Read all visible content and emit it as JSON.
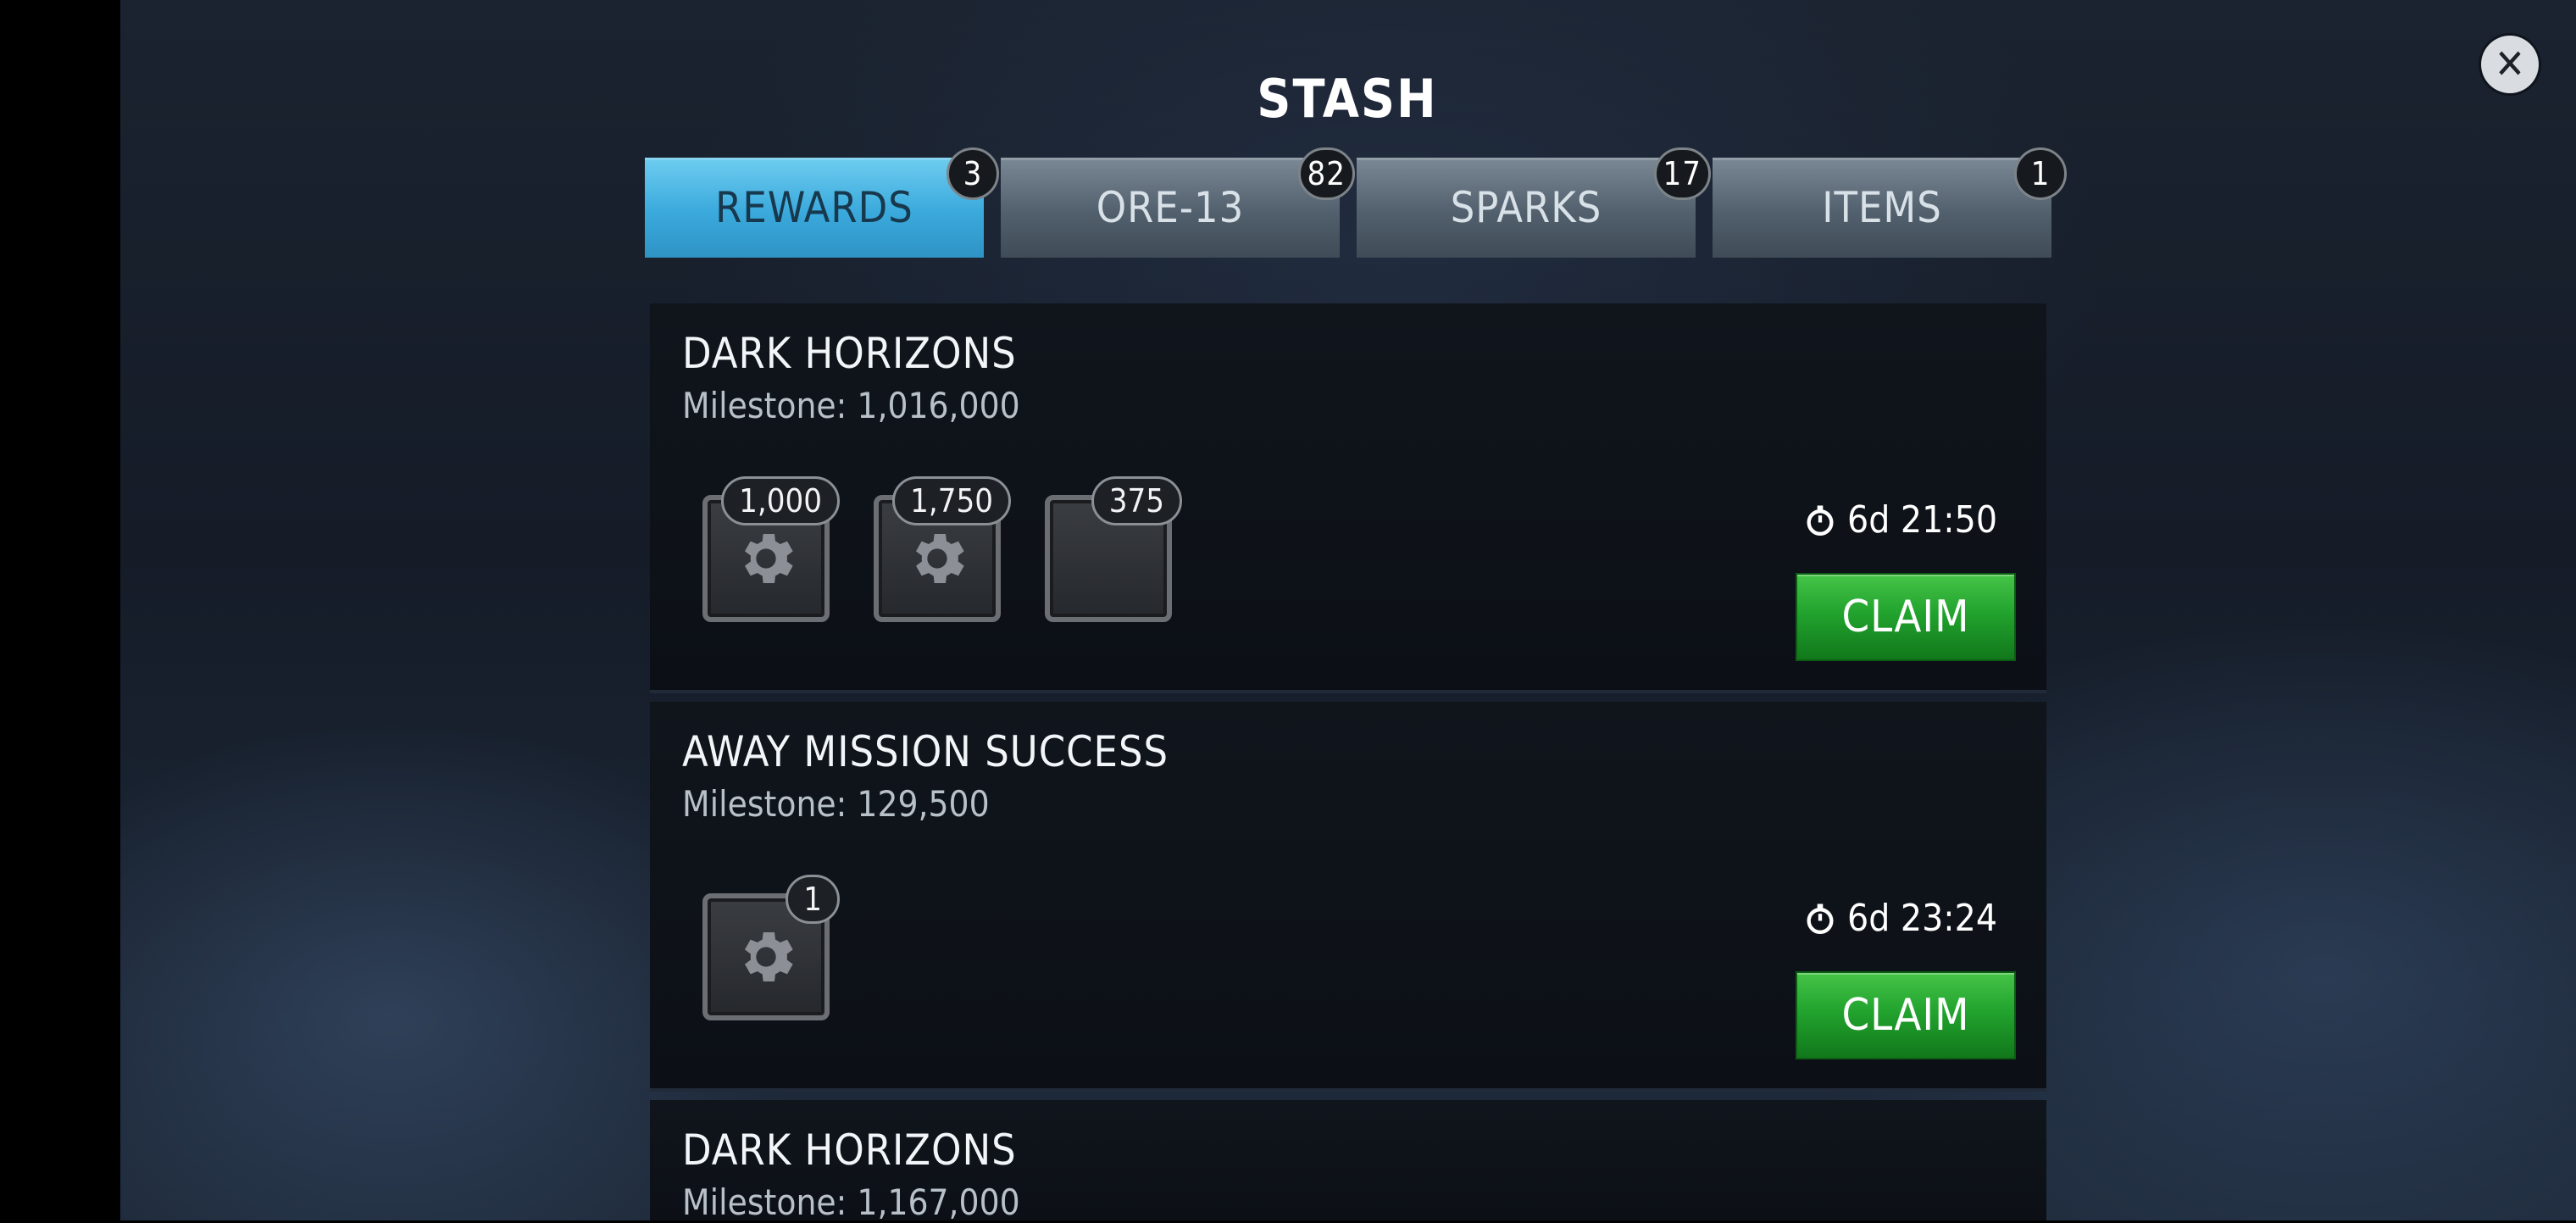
{
  "window": {
    "title": "STASH",
    "close_icon": "close-icon"
  },
  "tabs": [
    {
      "label": "REWARDS",
      "badge": "3",
      "active": true
    },
    {
      "label": "ORE-13",
      "badge": "82",
      "active": false
    },
    {
      "label": "SPARKS",
      "badge": "17",
      "active": false
    },
    {
      "label": "ITEMS",
      "badge": "1",
      "active": false
    }
  ],
  "rewards": [
    {
      "title": "DARK HORIZONS",
      "milestone": "Milestone: 1,016,000",
      "items": [
        {
          "icon": "gear-icon",
          "count": "1,000"
        },
        {
          "icon": "gear-icon",
          "count": "1,750"
        },
        {
          "icon": "",
          "count": "375"
        }
      ],
      "timer": "6d 21:50",
      "claim_label": "CLAIM"
    },
    {
      "title": "AWAY MISSION SUCCESS",
      "milestone": "Milestone: 129,500",
      "items": [
        {
          "icon": "gear-icon",
          "count": "1"
        }
      ],
      "timer": "6d 23:24",
      "claim_label": "CLAIM"
    },
    {
      "title": "DARK HORIZONS",
      "milestone": "Milestone: 1,167,000"
    }
  ],
  "colors": {
    "active_tab": "#3aa9dc",
    "claim_button": "#22a32e"
  }
}
